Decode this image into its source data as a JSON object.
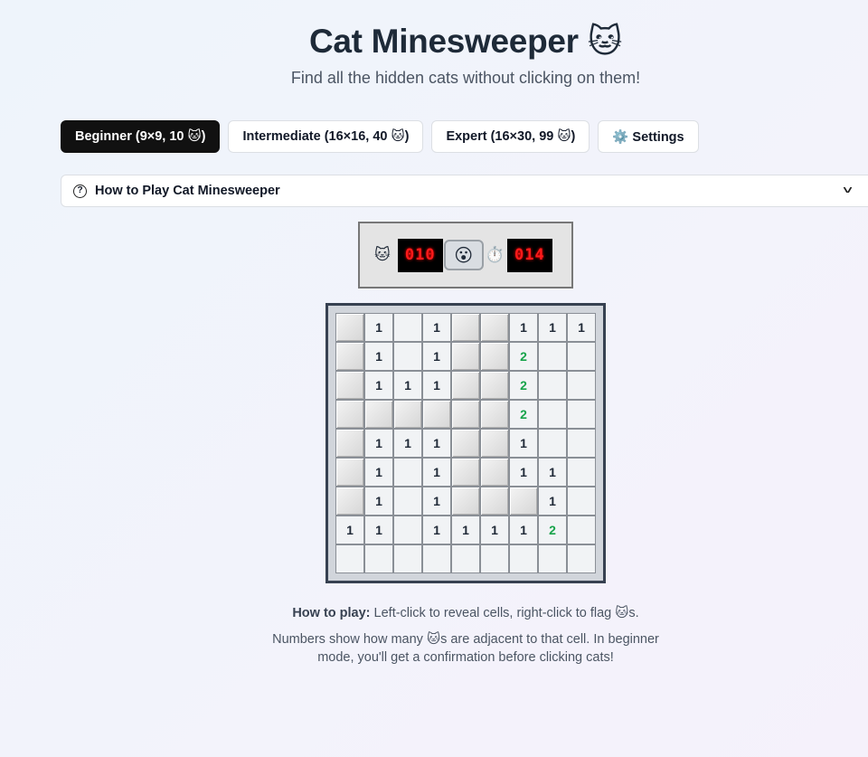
{
  "header": {
    "title": "Cat Minesweeper 🐱",
    "subtitle": "Find all the hidden cats without clicking on them!"
  },
  "modes": [
    {
      "label": "Beginner (9×9, 10 🐱)",
      "active": true
    },
    {
      "label": "Intermediate (16×16, 40 🐱)",
      "active": false
    },
    {
      "label": "Expert (16×30, 99 🐱)",
      "active": false
    },
    {
      "label": "⚙️ Settings",
      "active": false
    }
  ],
  "howto_panel": {
    "label": "How to Play Cat Minesweeper",
    "icon": "question-circle-icon",
    "chevron": "chevron-down-icon"
  },
  "status": {
    "cat_icon": "🐱",
    "cats_remaining": "010",
    "face": "😮",
    "timer_icon": "⏱️",
    "time": "014"
  },
  "board": {
    "rows": 9,
    "cols": 9,
    "cells": [
      [
        "H",
        "1",
        "R",
        "1",
        "H",
        "H",
        "1",
        "1",
        "1"
      ],
      [
        "H",
        "1",
        "R",
        "1",
        "H",
        "H",
        "2",
        "R",
        "R"
      ],
      [
        "H",
        "1",
        "1",
        "1",
        "H",
        "H",
        "2",
        "R",
        "R"
      ],
      [
        "H",
        "H",
        "H",
        "H",
        "H",
        "H",
        "2",
        "R",
        "R"
      ],
      [
        "H",
        "1",
        "1",
        "1",
        "H",
        "H",
        "1",
        "R",
        "R"
      ],
      [
        "H",
        "1",
        "R",
        "1",
        "H",
        "H",
        "1",
        "1",
        "R"
      ],
      [
        "H",
        "1",
        "R",
        "1",
        "H",
        "H",
        "H",
        "1",
        "R"
      ],
      [
        "1",
        "1",
        "R",
        "1",
        "1",
        "1",
        "1",
        "2",
        "R"
      ],
      [
        "R",
        "R",
        "R",
        "R",
        "R",
        "R",
        "R",
        "R",
        "R"
      ]
    ],
    "legend": {
      "H": "hidden",
      "R": "revealed-empty"
    }
  },
  "footer": {
    "howto_bold": "How to play:",
    "howto_text": " Left-click to reveal cells, right-click to flag 🐱s.",
    "note": "Numbers show how many 🐱s are adjacent to that cell. In beginner mode, you'll get a confirmation before clicking cats!"
  },
  "colors": {
    "active_button_bg": "#111111",
    "lcd_bg": "#000000",
    "lcd_text": "#ff1a1a",
    "number_1": "#1f2937",
    "number_2": "#16a34a"
  }
}
